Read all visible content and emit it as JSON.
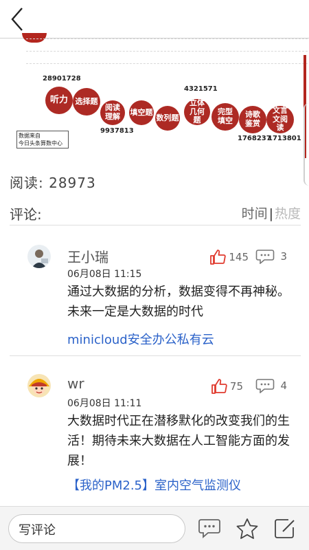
{
  "header": {
    "back_icon": "chevron-left-icon"
  },
  "infographic": {
    "numbers": {
      "listening": "28901728",
      "reading": "9937813",
      "geometry": "4321571",
      "poetry": "1768237",
      "classical": "1713801"
    },
    "bubbles": [
      "听力",
      "选择题",
      "阅读理解",
      "填空题",
      "数列题",
      "立体几何题",
      "完型填空",
      "诗歌鉴赏",
      "文言文阅读"
    ],
    "source_line1": "数据来自",
    "source_line2": "今日头条算数中心"
  },
  "stats": {
    "reads_label": "阅读:",
    "reads_value": "28973"
  },
  "comments_header": {
    "title": "评论:",
    "sort_time": "时间",
    "sort_hot": "热度"
  },
  "comments": [
    {
      "user": "王小瑞",
      "time": "06月08日 11:15",
      "text": "通过大数据的分析，数据变得不再神秘。未来一定是大数据的时代",
      "likes": "145",
      "replies": "3",
      "link": "minicloud安全办公私有云"
    },
    {
      "user": "wr",
      "time": "06月08日 11:11",
      "text": "大数据时代正在潜移默化的改变我们的生活！期待未来大数据在人工智能方面的发展！",
      "likes": "75",
      "replies": "4",
      "link": "【我的PM2.5】室内空气监测仪"
    }
  ],
  "bottom": {
    "write_placeholder": "写评论",
    "icons": [
      "comment-icon",
      "star-icon",
      "edit-icon"
    ]
  },
  "colors": {
    "accent_red": "#ad2a24",
    "link_blue": "#2b62c9",
    "like_red": "#e03a2e"
  }
}
